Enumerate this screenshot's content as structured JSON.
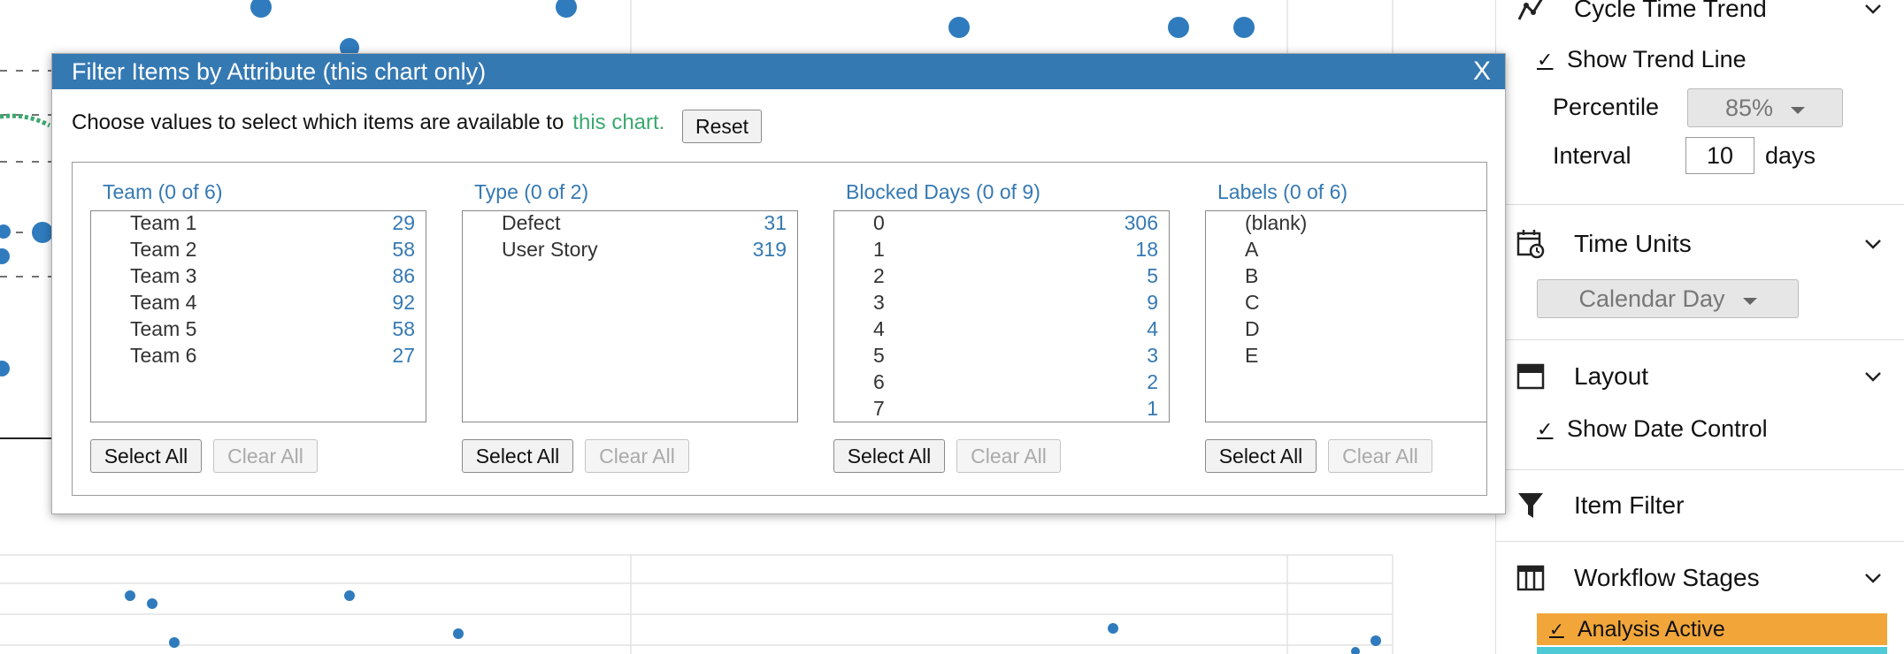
{
  "modal": {
    "title": "Filter Items by Attribute (this chart only)",
    "close_label": "X",
    "intro_text": "Choose values to select which items are available to",
    "intro_highlight": "this chart.",
    "reset_label": "Reset",
    "select_all_label": "Select All",
    "clear_all_label": "Clear All",
    "columns": [
      {
        "title": "Team (0 of 6)",
        "items": [
          {
            "name": "Team 1",
            "count": "29"
          },
          {
            "name": "Team 2",
            "count": "58"
          },
          {
            "name": "Team 3",
            "count": "86"
          },
          {
            "name": "Team 4",
            "count": "92"
          },
          {
            "name": "Team 5",
            "count": "58"
          },
          {
            "name": "Team 6",
            "count": "27"
          }
        ]
      },
      {
        "title": "Type (0 of 2)",
        "items": [
          {
            "name": "Defect",
            "count": "31"
          },
          {
            "name": "User Story",
            "count": "319"
          }
        ]
      },
      {
        "title": "Blocked Days (0 of 9)",
        "items": [
          {
            "name": "0",
            "count": "306"
          },
          {
            "name": "1",
            "count": "18"
          },
          {
            "name": "2",
            "count": "5"
          },
          {
            "name": "3",
            "count": "9"
          },
          {
            "name": "4",
            "count": "4"
          },
          {
            "name": "5",
            "count": "3"
          },
          {
            "name": "6",
            "count": "2"
          },
          {
            "name": "7",
            "count": "1"
          }
        ]
      },
      {
        "title": "Labels (0 of 6)",
        "items": [
          {
            "name": "(blank)",
            "count": ""
          },
          {
            "name": "A",
            "count": ""
          },
          {
            "name": "B",
            "count": ""
          },
          {
            "name": "C",
            "count": ""
          },
          {
            "name": "D",
            "count": ""
          },
          {
            "name": "E",
            "count": ""
          }
        ]
      }
    ]
  },
  "right_panel": {
    "cycle_time_trend": {
      "title": "Cycle Time Trend",
      "show_trend_line": "Show Trend Line",
      "percentile_label": "Percentile",
      "percentile_value": "85%",
      "interval_label": "Interval",
      "interval_value": "10",
      "interval_unit": "days"
    },
    "time_units": {
      "title": "Time Units",
      "value": "Calendar Day"
    },
    "layout": {
      "title": "Layout",
      "show_date_control": "Show Date Control"
    },
    "item_filter": {
      "title": "Item Filter"
    },
    "workflow_stages": {
      "title": "Workflow Stages",
      "stage_1": "Analysis Active",
      "stage_1_color": "#f2a63a",
      "stage_2_color": "#4ec9d6"
    }
  },
  "colors": {
    "accent": "#3579b3",
    "dot": "#2f7bbd",
    "trend": "#3aa86f",
    "highlight_green": "#3aa86f"
  }
}
